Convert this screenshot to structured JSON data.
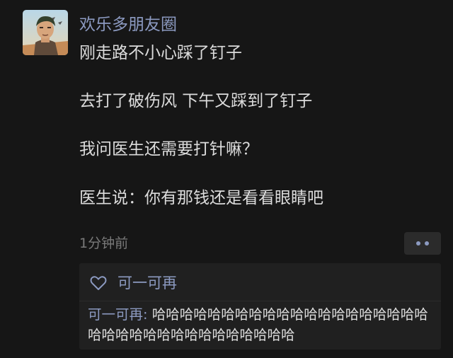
{
  "post": {
    "author": "欢乐多朋友圈",
    "lines": [
      "刚走路不小心踩了钉子",
      "去打了破伤风 下午又踩到了钉子",
      "我问医生还需要打针嘛？",
      "医生说：你有那钱还是看看眼睛吧"
    ],
    "timestamp": "1分钟前"
  },
  "interactions": {
    "likes": [
      "可一可再"
    ],
    "comments": [
      {
        "author": "可一可再",
        "separator": ": ",
        "text": "哈哈哈哈哈哈哈哈哈哈哈哈哈哈哈哈哈哈哈哈哈哈哈哈哈哈哈哈哈哈哈哈哈哈哈"
      }
    ]
  },
  "icons": {
    "avatar": "avatar-image",
    "like": "heart-outline-icon",
    "more": "more-dots-icon"
  },
  "colors": {
    "background": "#161616",
    "link": "#8c9ac1",
    "text": "#dcdcdc",
    "muted": "#7a7a7a",
    "panel": "#202020"
  }
}
